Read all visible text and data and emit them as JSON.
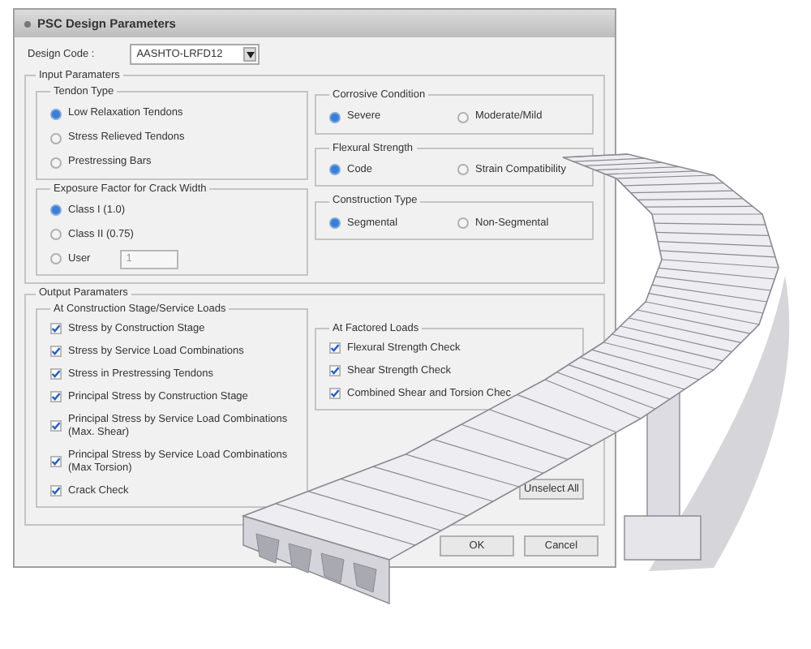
{
  "window": {
    "title": "PSC Design Parameters"
  },
  "design_code": {
    "label": "Design Code :",
    "value": "AASHTO-LRFD12"
  },
  "input_parameters": {
    "title": "Input Paramaters",
    "left_groups": [
      {
        "title": "Tendon Type",
        "kind": "vertical",
        "options": [
          {
            "label": "Low Relaxation Tendons",
            "selected": true
          },
          {
            "label": "Stress Relieved Tendons",
            "selected": false
          },
          {
            "label": "Prestressing Bars",
            "selected": false
          }
        ]
      },
      {
        "title": "Exposure Factor for Crack Width",
        "kind": "vertical",
        "options": [
          {
            "label": "Class I (1.0)",
            "selected": true
          },
          {
            "label": "Class II (0.75)",
            "selected": false
          },
          {
            "label": "User",
            "selected": false,
            "value": "1"
          }
        ]
      }
    ],
    "right_groups": [
      {
        "title": "Corrosive Condition",
        "kind": "horizontal",
        "options": [
          {
            "label": "Severe",
            "selected": true
          },
          {
            "label": "Moderate/Mild",
            "selected": false
          }
        ]
      },
      {
        "title": "Flexural Strength",
        "kind": "horizontal",
        "options": [
          {
            "label": "Code",
            "selected": true
          },
          {
            "label": "Strain Compatibility",
            "selected": false
          }
        ]
      },
      {
        "title": "Construction Type",
        "kind": "horizontal",
        "options": [
          {
            "label": "Segmental",
            "selected": true
          },
          {
            "label": "Non-Segmental",
            "selected": false
          }
        ]
      }
    ]
  },
  "output_parameters": {
    "title": "Output Paramaters",
    "groups": [
      {
        "title": "At Construction Stage/Service Loads",
        "items": [
          {
            "label": "Stress by Construction Stage",
            "checked": true
          },
          {
            "label": "Stress by Service Load Combinations",
            "checked": true
          },
          {
            "label": "Stress in Prestressing Tendons",
            "checked": true
          },
          {
            "label": "Principal Stress by Construction Stage",
            "checked": true
          },
          {
            "label": "Principal Stress by Service Load Combinations\n(Max. Shear)",
            "checked": true
          },
          {
            "label": "Principal Stress by Service Load Combinations\n(Max Torsion)",
            "checked": true
          },
          {
            "label": "Crack Check",
            "checked": true
          }
        ]
      },
      {
        "title": "At Factored Loads",
        "items": [
          {
            "label": "Flexural Strength Check",
            "checked": true
          },
          {
            "label": "Shear Strength Check",
            "checked": true
          },
          {
            "label": "Combined Shear and Torsion Chec",
            "checked": true
          }
        ]
      }
    ]
  },
  "unselect_button": "Unselect All",
  "buttons": [
    "OK",
    "Cancel"
  ]
}
